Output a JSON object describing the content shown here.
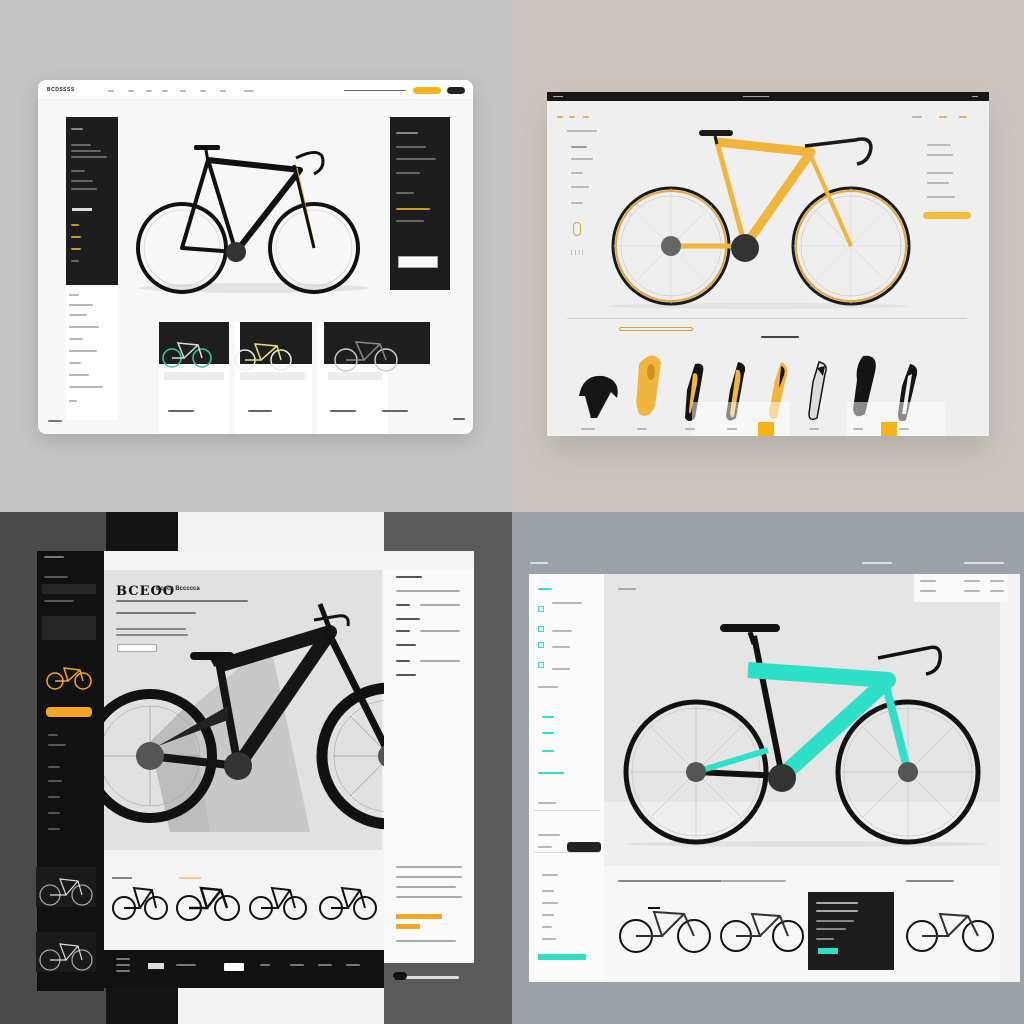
{
  "q1": {
    "brand": "BCDSSSS",
    "nav": [
      "",
      "",
      "",
      "",
      "",
      "",
      "",
      ""
    ],
    "accent": "#f5b41a"
  },
  "q2": {
    "header_left": "",
    "header_center": "",
    "frame_color": "#f0b53a",
    "accent": "#f5b41a",
    "gear_items": [
      "helmet",
      "saddle",
      "frame-part",
      "frame-part",
      "frame-part",
      "frame-part",
      "frame-part",
      "frame-part"
    ]
  },
  "q3": {
    "title": "BCEOO",
    "subtitle": "Bcccs Bccccca",
    "accent": "#f5a623"
  },
  "q4": {
    "frame_color": "#2de0c7",
    "sidebar_accent": "#2de0c7",
    "cta_label": "",
    "card_button": ""
  }
}
